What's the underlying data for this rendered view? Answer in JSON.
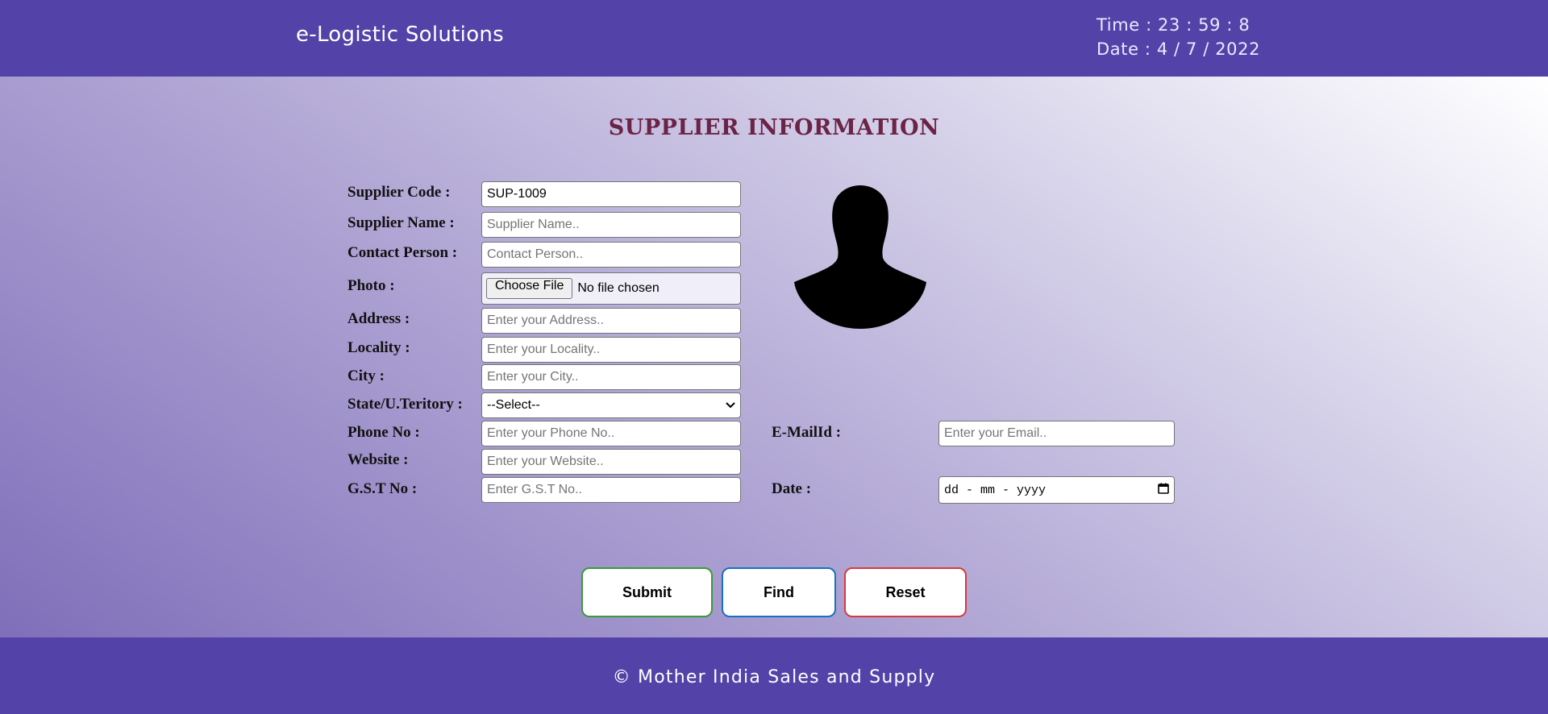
{
  "header": {
    "brand": "e-Logistic Solutions",
    "time": "Time : 23 : 59 : 8",
    "date": "Date : 4 / 7 / 2022"
  },
  "form": {
    "title": "SUPPLIER INFORMATION",
    "supplier_code": {
      "label": "Supplier Code :",
      "value": "SUP-1009"
    },
    "supplier_name": {
      "label": "Supplier Name :",
      "placeholder": "Supplier Name.."
    },
    "contact_person": {
      "label": "Contact Person :",
      "placeholder": "Contact Person.."
    },
    "photo": {
      "label": "Photo :",
      "button": "Choose File",
      "status": "No file chosen"
    },
    "address": {
      "label": "Address :",
      "placeholder": "Enter your Address.."
    },
    "locality": {
      "label": "Locality :",
      "placeholder": "Enter your Locality.."
    },
    "city": {
      "label": "City :",
      "placeholder": "Enter your City.."
    },
    "state": {
      "label": "State/U.Teritory :",
      "selected": "--Select--"
    },
    "phone": {
      "label": "Phone No :",
      "placeholder": "Enter your Phone No.."
    },
    "website": {
      "label": "Website :",
      "placeholder": "Enter your Website.."
    },
    "gst": {
      "label": "G.S.T No :",
      "placeholder": "Enter G.S.T No.."
    },
    "email": {
      "label": "E-MailId :",
      "placeholder": "Enter your Email.."
    },
    "date": {
      "label": "Date :",
      "placeholder": "dd - mm - yyyy"
    }
  },
  "buttons": {
    "submit": "Submit",
    "find": "Find",
    "reset": "Reset",
    "submit_color": "#3a9b3a",
    "find_color": "#1b6fc2",
    "reset_color": "#d63b3b"
  },
  "footer": {
    "text": "© Mother India Sales and Supply"
  },
  "icons": {
    "avatar": "person-silhouette-icon",
    "calendar": "calendar-icon",
    "dropdown": "chevron-down-icon"
  },
  "colors": {
    "bar": "#5343a8",
    "title": "#6b2346"
  }
}
